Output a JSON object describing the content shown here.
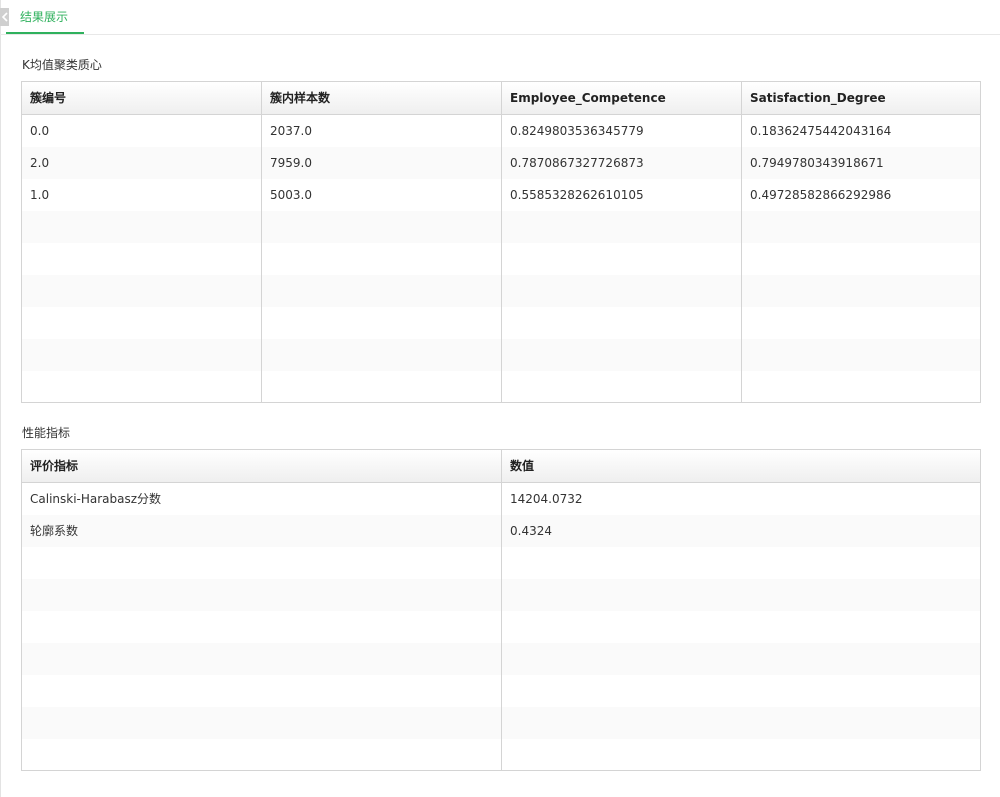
{
  "tabs": [
    {
      "label": "结果展示",
      "active": true
    }
  ],
  "accent_color": "#2fb15d",
  "centroids": {
    "title": "K均值聚类质心",
    "columns": [
      "簇编号",
      "簇内样本数",
      "Employee_Competence",
      "Satisfaction_Degree"
    ],
    "rows": [
      [
        "0.0",
        "2037.0",
        "0.8249803536345779",
        "0.18362475442043164"
      ],
      [
        "2.0",
        "7959.0",
        "0.7870867327726873",
        "0.7949780343918671"
      ],
      [
        "1.0",
        "5003.0",
        "0.5585328262610105",
        "0.49728582866292986"
      ]
    ]
  },
  "metrics": {
    "title": "性能指标",
    "columns": [
      "评价指标",
      "数值"
    ],
    "rows": [
      [
        "Calinski-Harabasz分数",
        "14204.0732"
      ],
      [
        "轮廓系数",
        "0.4324"
      ]
    ]
  }
}
